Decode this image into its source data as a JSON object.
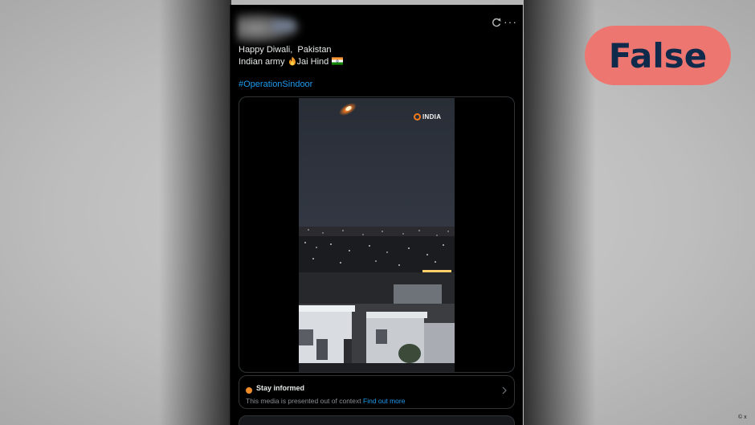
{
  "tweet": {
    "text_line1": "Happy Diwali,  Pakistan",
    "text_line2_prefix": "Indian army ",
    "text_line2_suffix": "Jai Hind",
    "hashtag": "#OperationSindoor",
    "line2_icons": [
      "fire-icon",
      "india-flag-icon"
    ],
    "header_icons": [
      "refresh-icon",
      "more-icon"
    ]
  },
  "media": {
    "channel_logo_text": "INDIA"
  },
  "context_note": {
    "title": "Stay informed",
    "body": "This media is presented out of context",
    "link": "Find out more"
  },
  "verdict": {
    "label": "False",
    "badge_color": "#ee7670",
    "text_color": "#102a4c"
  },
  "credit": "© x",
  "colors": {
    "link": "#1d9bf0",
    "card_bg": "#000000",
    "info_dot": "#f08c2a"
  }
}
